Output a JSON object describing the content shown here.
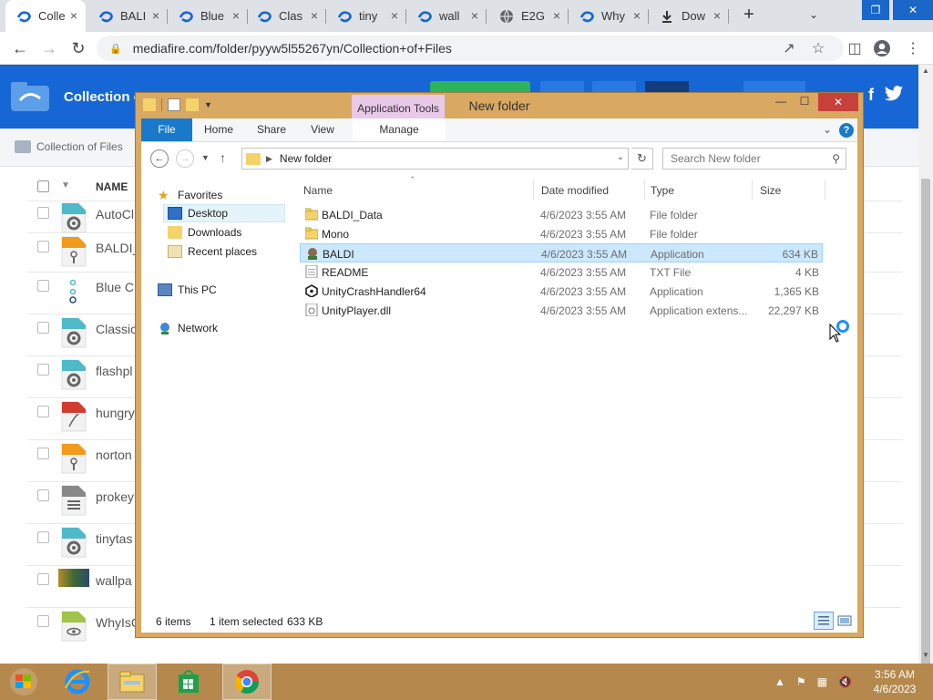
{
  "browser": {
    "tabs": [
      {
        "title": "Colle",
        "active": true
      },
      {
        "title": "BALI",
        "active": false
      },
      {
        "title": "Blue",
        "active": false
      },
      {
        "title": "Clas",
        "active": false
      },
      {
        "title": "tiny",
        "active": false
      },
      {
        "title": "wall",
        "active": false
      },
      {
        "title": "E2G",
        "active": false
      },
      {
        "title": "Why",
        "active": false
      },
      {
        "title": "Dow",
        "active": false
      }
    ],
    "new_tab_glyph": "+",
    "url": "mediafire.com/folder/pyyw5l55267yn/Collection+of+Files"
  },
  "mediafire": {
    "title": "Collection o",
    "breadcrumb": "Collection of Files",
    "name_header": "NAME",
    "files": [
      {
        "name": "AutoCl",
        "icon": "gear-file-icon",
        "color": "#4fb8c9"
      },
      {
        "name": "BALDI_",
        "icon": "zip-file-icon",
        "color": "#f39a1c"
      },
      {
        "name": "Blue C",
        "icon": "zip-file-icon",
        "color": "#4fb8c9"
      },
      {
        "name": "Classic",
        "icon": "gear-file-icon",
        "color": "#4fb8c9"
      },
      {
        "name": "flashpl",
        "icon": "gear-file-icon",
        "color": "#4fb8c9"
      },
      {
        "name": "hungry",
        "icon": "pdf-file-icon",
        "color": "#d13b30"
      },
      {
        "name": "norton",
        "icon": "zip-file-icon",
        "color": "#f39a1c"
      },
      {
        "name": "prokey",
        "icon": "doc-file-icon",
        "color": "#888888"
      },
      {
        "name": "tinytas",
        "icon": "gear-file-icon",
        "color": "#4fb8c9"
      },
      {
        "name": "wallpa",
        "icon": "image-thumbnail-icon",
        "color": "#6b8a3a"
      },
      {
        "name": "WhyIsC",
        "icon": "eye-file-icon",
        "color": "#a0c34a"
      }
    ]
  },
  "explorer": {
    "title": "New folder",
    "app_tools": "Application Tools",
    "ribbon_tabs": [
      "File",
      "Home",
      "Share",
      "View",
      "Manage"
    ],
    "address": "New folder",
    "search_placeholder": "Search New folder",
    "nav": {
      "favorites": "Favorites",
      "desktop": "Desktop",
      "downloads": "Downloads",
      "recent": "Recent places",
      "this_pc": "This PC",
      "network": "Network"
    },
    "columns": [
      "Name",
      "Date modified",
      "Type",
      "Size"
    ],
    "files": [
      {
        "name": "BALDI_Data",
        "date": "4/6/2023 3:55 AM",
        "type": "File folder",
        "size": "",
        "icon": "folder-icon",
        "selected": false
      },
      {
        "name": "Mono",
        "date": "4/6/2023 3:55 AM",
        "type": "File folder",
        "size": "",
        "icon": "folder-icon",
        "selected": false
      },
      {
        "name": "BALDI",
        "date": "4/6/2023 3:55 AM",
        "type": "Application",
        "size": "634 KB",
        "icon": "baldi-app-icon",
        "selected": true
      },
      {
        "name": "README",
        "date": "4/6/2023 3:55 AM",
        "type": "TXT File",
        "size": "4 KB",
        "icon": "text-file-icon",
        "selected": false
      },
      {
        "name": "UnityCrashHandler64",
        "date": "4/6/2023 3:55 AM",
        "type": "Application",
        "size": "1,365 KB",
        "icon": "unity-icon",
        "selected": false
      },
      {
        "name": "UnityPlayer.dll",
        "date": "4/6/2023 3:55 AM",
        "type": "Application extens...",
        "size": "22,297 KB",
        "icon": "dll-file-icon",
        "selected": false
      }
    ],
    "status": {
      "items": "6 items",
      "selected": "1 item selected",
      "size": "633 KB"
    }
  },
  "taskbar": {
    "apps": [
      "internet-explorer-icon",
      "file-explorer-icon",
      "store-icon",
      "chrome-icon"
    ],
    "clock_time": "3:56 AM",
    "clock_date": "4/6/2023"
  },
  "colors": {
    "explorer_frame": "#d9a861",
    "taskbar": "#b5894d",
    "mediafire_blue": "#1766d5",
    "selection": "#cce8ff",
    "file_tab": "#1979ca"
  }
}
